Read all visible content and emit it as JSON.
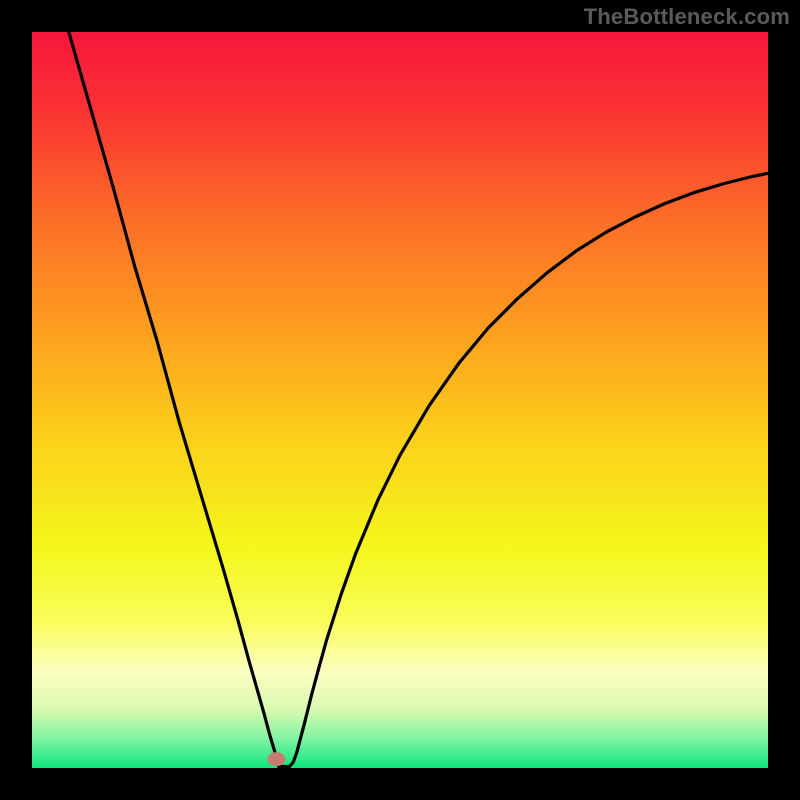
{
  "watermark": "TheBottleneck.com",
  "chart_data": {
    "type": "line",
    "title": "",
    "xlabel": "",
    "ylabel": "",
    "xlim": [
      0,
      100
    ],
    "ylim": [
      0,
      100
    ],
    "grid": false,
    "series": [
      {
        "name": "bottleneck-curve",
        "x": [
          5,
          7,
          9,
          11,
          14,
          17,
          20,
          23,
          26,
          28,
          29.5,
          30.5,
          31.5,
          32.3,
          33.2,
          33.5,
          34,
          34.5,
          35,
          35.5,
          36,
          37,
          38,
          39,
          40,
          42,
          44,
          47,
          50,
          54,
          58,
          62,
          66,
          70,
          74,
          78,
          82,
          86,
          90,
          94,
          98,
          100
        ],
        "y": [
          100,
          93,
          86,
          79,
          68,
          58,
          47,
          37,
          27,
          20,
          14.5,
          11,
          7.5,
          4.5,
          1.5,
          0.2,
          0.2,
          0.2,
          0.2,
          0.8,
          2.2,
          6,
          10,
          13.7,
          17.3,
          23.6,
          29.2,
          36.4,
          42.5,
          49.3,
          55,
          59.8,
          63.8,
          67.3,
          70.3,
          72.8,
          74.9,
          76.7,
          78.2,
          79.4,
          80.4,
          80.8
        ]
      }
    ],
    "marker": {
      "name": "highlight-point",
      "x": 33.2,
      "y": 1.2,
      "color": "#c87b6f"
    },
    "gradient_stops": [
      {
        "offset": 0.0,
        "color": "#f6173c"
      },
      {
        "offset": 0.1,
        "color": "#fa3033"
      },
      {
        "offset": 0.25,
        "color": "#fc6c28"
      },
      {
        "offset": 0.4,
        "color": "#fd9d1f"
      },
      {
        "offset": 0.55,
        "color": "#fccf1b"
      },
      {
        "offset": 0.7,
        "color": "#f4f71c"
      },
      {
        "offset": 0.8,
        "color": "#f9fd59"
      },
      {
        "offset": 0.87,
        "color": "#fcfec2"
      },
      {
        "offset": 0.92,
        "color": "#d9fbb0"
      },
      {
        "offset": 0.96,
        "color": "#80f4a3"
      },
      {
        "offset": 1.0,
        "color": "#0fe67e"
      }
    ]
  }
}
